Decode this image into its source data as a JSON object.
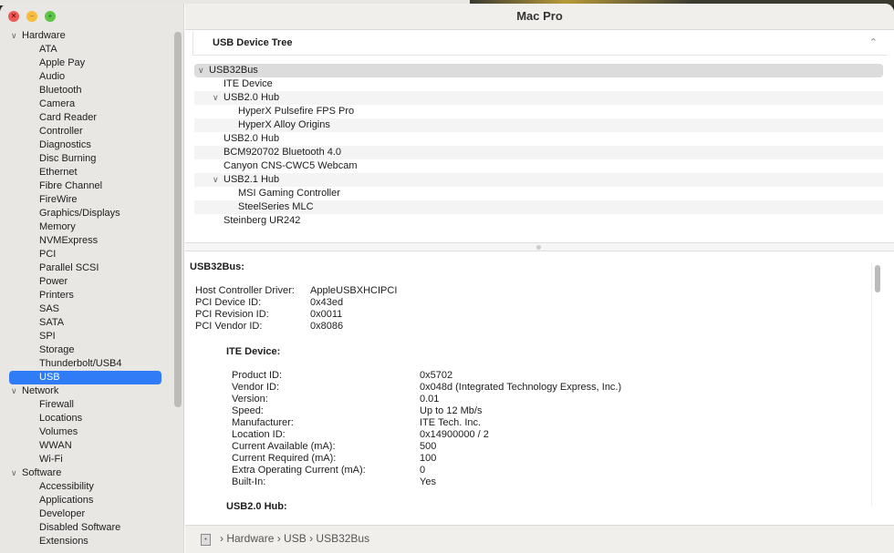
{
  "window": {
    "title": "Mac Pro"
  },
  "sidebar": {
    "items": [
      {
        "label": "Hardware",
        "type": "group"
      },
      {
        "label": "ATA"
      },
      {
        "label": "Apple Pay"
      },
      {
        "label": "Audio"
      },
      {
        "label": "Bluetooth"
      },
      {
        "label": "Camera"
      },
      {
        "label": "Card Reader"
      },
      {
        "label": "Controller"
      },
      {
        "label": "Diagnostics"
      },
      {
        "label": "Disc Burning"
      },
      {
        "label": "Ethernet"
      },
      {
        "label": "Fibre Channel"
      },
      {
        "label": "FireWire"
      },
      {
        "label": "Graphics/Displays"
      },
      {
        "label": "Memory"
      },
      {
        "label": "NVMExpress"
      },
      {
        "label": "PCI"
      },
      {
        "label": "Parallel SCSI"
      },
      {
        "label": "Power"
      },
      {
        "label": "Printers"
      },
      {
        "label": "SAS"
      },
      {
        "label": "SATA"
      },
      {
        "label": "SPI"
      },
      {
        "label": "Storage"
      },
      {
        "label": "Thunderbolt/USB4"
      },
      {
        "label": "USB",
        "selected": true
      },
      {
        "label": "Network",
        "type": "group"
      },
      {
        "label": "Firewall"
      },
      {
        "label": "Locations"
      },
      {
        "label": "Volumes"
      },
      {
        "label": "WWAN"
      },
      {
        "label": "Wi-Fi"
      },
      {
        "label": "Software",
        "type": "group"
      },
      {
        "label": "Accessibility"
      },
      {
        "label": "Applications"
      },
      {
        "label": "Developer"
      },
      {
        "label": "Disabled Software"
      },
      {
        "label": "Extensions"
      }
    ]
  },
  "tree": {
    "header": "USB Device Tree",
    "rows": [
      {
        "label": "USB32Bus",
        "level": 0,
        "expandable": true,
        "selected": true
      },
      {
        "label": "ITE Device",
        "level": 1
      },
      {
        "label": "USB2.0 Hub",
        "level": 1,
        "expandable": true
      },
      {
        "label": "HyperX Pulsefire FPS Pro",
        "level": 2
      },
      {
        "label": "HyperX Alloy Origins",
        "level": 2
      },
      {
        "label": "USB2.0 Hub",
        "level": 1
      },
      {
        "label": "BCM920702 Bluetooth 4.0",
        "level": 1
      },
      {
        "label": "Canyon CNS-CWC5 Webcam",
        "level": 1
      },
      {
        "label": "USB2.1 Hub",
        "level": 1,
        "expandable": true
      },
      {
        "label": "MSI Gaming Controller",
        "level": 2
      },
      {
        "label": "SteelSeries MLC",
        "level": 2
      },
      {
        "label": "Steinberg UR242",
        "level": 1
      }
    ]
  },
  "detail": {
    "title": "USB32Bus:",
    "props": [
      [
        "Host Controller Driver:",
        "AppleUSBXHCIPCI"
      ],
      [
        "PCI Device ID:",
        "0x43ed"
      ],
      [
        "PCI Revision ID:",
        "0x0011"
      ],
      [
        "PCI Vendor ID:",
        "0x8086"
      ]
    ],
    "sub_title": "ITE Device:",
    "sub_props": [
      [
        "Product ID:",
        "0x5702"
      ],
      [
        "Vendor ID:",
        "0x048d  (Integrated Technology Express, Inc.)"
      ],
      [
        "Version:",
        "0.01"
      ],
      [
        "Speed:",
        "Up to 12 Mb/s"
      ],
      [
        "Manufacturer:",
        "ITE Tech. Inc."
      ],
      [
        "Location ID:",
        "0x14900000 / 2"
      ],
      [
        "Current Available (mA):",
        "500"
      ],
      [
        "Current Required (mA):",
        "100"
      ],
      [
        "Extra Operating Current (mA):",
        "0"
      ],
      [
        "Built-In:",
        "Yes"
      ]
    ],
    "next_title": "USB2.0 Hub:"
  },
  "breadcrumb": [
    "Hardware",
    "USB",
    "USB32Bus"
  ],
  "colors": {
    "selection": "#2f7cf6"
  }
}
